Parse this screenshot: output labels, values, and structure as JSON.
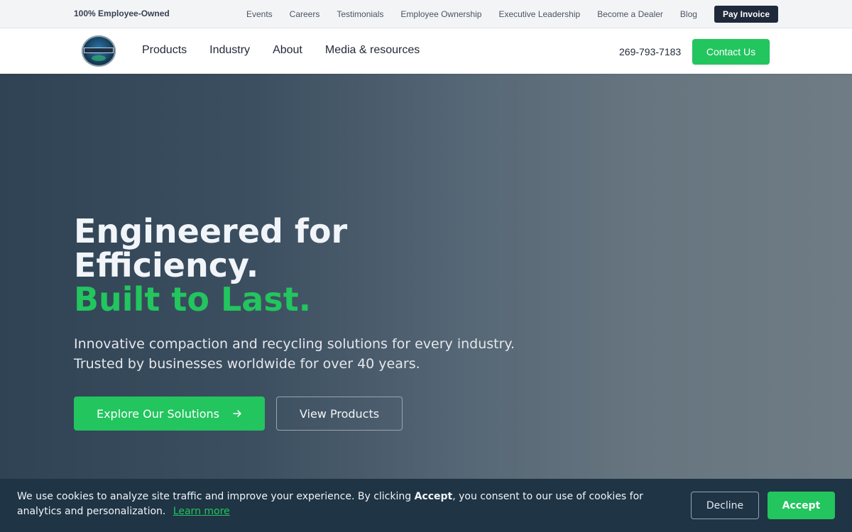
{
  "topbar": {
    "badge": "100% Employee-Owned",
    "links": [
      "Events",
      "Careers",
      "Testimonials",
      "Employee Ownership",
      "Executive Leadership",
      "Become a Dealer",
      "Blog"
    ],
    "pay_invoice": "Pay Invoice"
  },
  "navbar": {
    "logo_text": "SEBRIGHT PRODUCTS",
    "items": [
      "Products",
      "Industry",
      "About",
      "Media & resources"
    ],
    "phone": "269-793-7183",
    "contact_label": "Contact Us"
  },
  "hero": {
    "title_line1": "Engineered for Efficiency.",
    "title_line2": "Built to Last.",
    "subtitle_line1": "Innovative compaction and recycling solutions for every industry.",
    "subtitle_line2": "Trusted by businesses worldwide for over 40 years.",
    "primary_cta": "Explore Our Solutions",
    "secondary_cta": "View Products"
  },
  "cookie": {
    "text_before": "We use cookies to analyze site traffic and improve your experience. By clicking ",
    "text_bold": "Accept",
    "text_after": ", you consent to our use of cookies for analytics and personalization.",
    "learn_more": "Learn more",
    "decline": "Decline",
    "accept": "Accept"
  },
  "colors": {
    "accent": "#22c55e",
    "dark": "#1e293b",
    "cookie_bg": "#1f3444"
  },
  "icons": {
    "cta_arrow": "arrow-right-icon"
  }
}
